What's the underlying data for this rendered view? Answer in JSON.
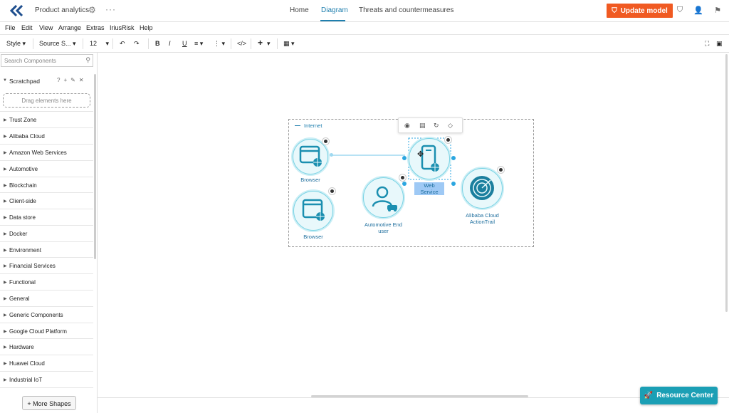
{
  "header": {
    "project_name": "Product analytics",
    "tabs": [
      {
        "label": "Home"
      },
      {
        "label": "Diagram"
      },
      {
        "label": "Threats and countermeasures"
      }
    ],
    "update_button": "Update model"
  },
  "menu": [
    "File",
    "Edit",
    "View",
    "Arrange",
    "Extras",
    "IriusRisk",
    "Help"
  ],
  "toolbar": {
    "style": "Style",
    "font": "Source S...",
    "size": "12",
    "bold": "B",
    "italic": "I",
    "underline": "U",
    "code": "</>",
    "plus": "+"
  },
  "sidebar": {
    "search_placeholder": "Search Components",
    "scratchpad": "Scratchpad",
    "drop_hint": "Drag elements here",
    "categories": [
      "Trust Zone",
      "Alibaba Cloud",
      "Amazon Web Services",
      "Automotive",
      "Blockchain",
      "Client-side",
      "Data store",
      "Docker",
      "Environment",
      "Financial Services",
      "Functional",
      "General",
      "Generic Components",
      "Google Cloud Platform",
      "Hardware",
      "Huawei Cloud",
      "Industrial IoT"
    ],
    "more_shapes": "+ More Shapes"
  },
  "diagram": {
    "zone_label": "Internet",
    "nodes": [
      {
        "label": "Browser",
        "icon": "browser-globe-icon"
      },
      {
        "label": "Browser",
        "icon": "browser-globe-icon"
      },
      {
        "label": "Automotive End user",
        "icon": "user-car-icon"
      },
      {
        "label": "Web Service",
        "icon": "mobile-globe-icon"
      },
      {
        "label": "Alibaba Cloud ActionTrail",
        "icon": "radar-icon"
      }
    ],
    "accent_color": "#1f7fae"
  },
  "resource_center": "Resource Center"
}
